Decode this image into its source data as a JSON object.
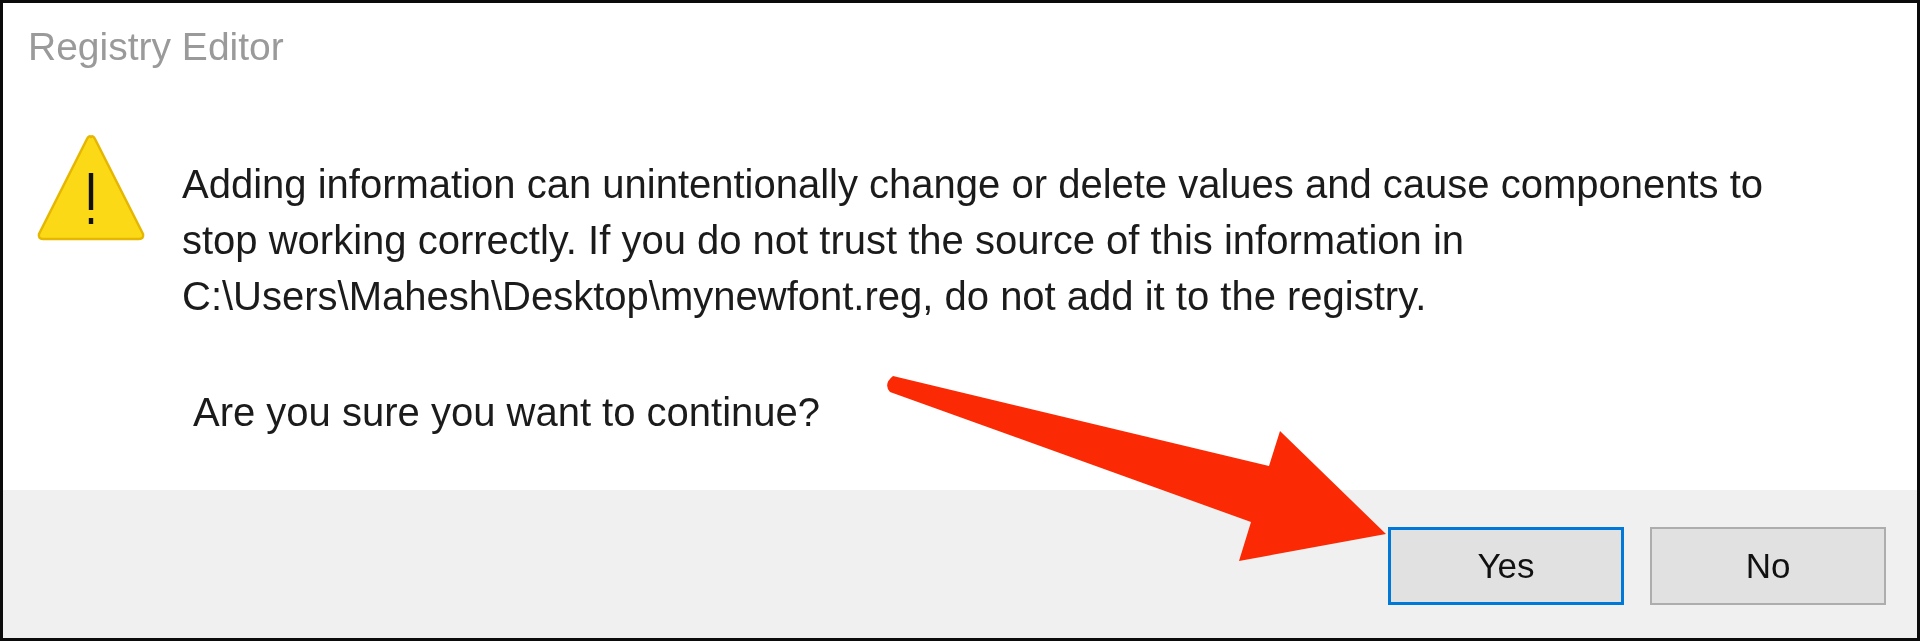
{
  "window": {
    "title": "Registry Editor"
  },
  "message": {
    "text": "Adding information can unintentionally change or delete values and cause components to stop working correctly. If you do not trust the source of this information in C:\\Users\\Mahesh\\Desktop\\mynewfont.reg, do not add it to the registry.",
    "question": "Are you sure you want to continue?"
  },
  "buttons": [
    {
      "label": "Yes",
      "focused": true
    },
    {
      "label": "No",
      "focused": false
    }
  ]
}
